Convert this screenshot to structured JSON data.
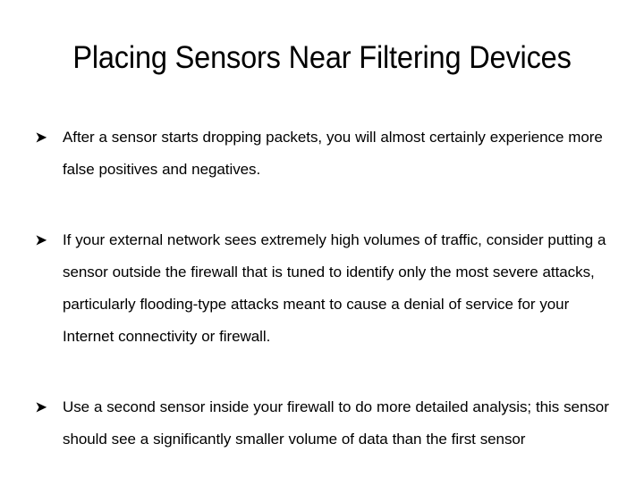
{
  "slide": {
    "title": "Placing Sensors Near Filtering Devices",
    "title_line1": "Placing Sensors Near Filtering",
    "title_line2": "Devices",
    "background_color": "#ffffff",
    "text_color": "#000000",
    "bullet_glyph": "arrow-right-marker",
    "bullets": [
      {
        "marker": "➢",
        "text": "After a sensor starts dropping packets, you will almost certainly experience more false positives and negatives."
      },
      {
        "marker": "➢",
        "text": "If your external network sees extremely high volumes of traffic, consider putting a sensor outside the firewall that is tuned to identify only the most severe attacks, particularly flooding-type attacks meant to cause a denial of service for your Internet connectivity or firewall."
      },
      {
        "marker": "➢",
        "text": "Use a second sensor inside your firewall to do more detailed analysis; this sensor should see a significantly smaller volume of data than the first sensor"
      }
    ]
  }
}
